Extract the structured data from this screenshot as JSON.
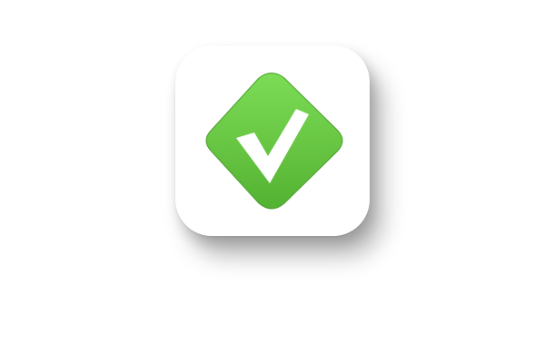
{
  "app_icon": {
    "icon": "checkmark-icon",
    "tile_color": "#ffffff",
    "badge_color_top": "#7ddc56",
    "badge_color_bottom": "#54b232",
    "badge_edge_color": "#4a9e2d",
    "check_color": "#ffffff"
  }
}
